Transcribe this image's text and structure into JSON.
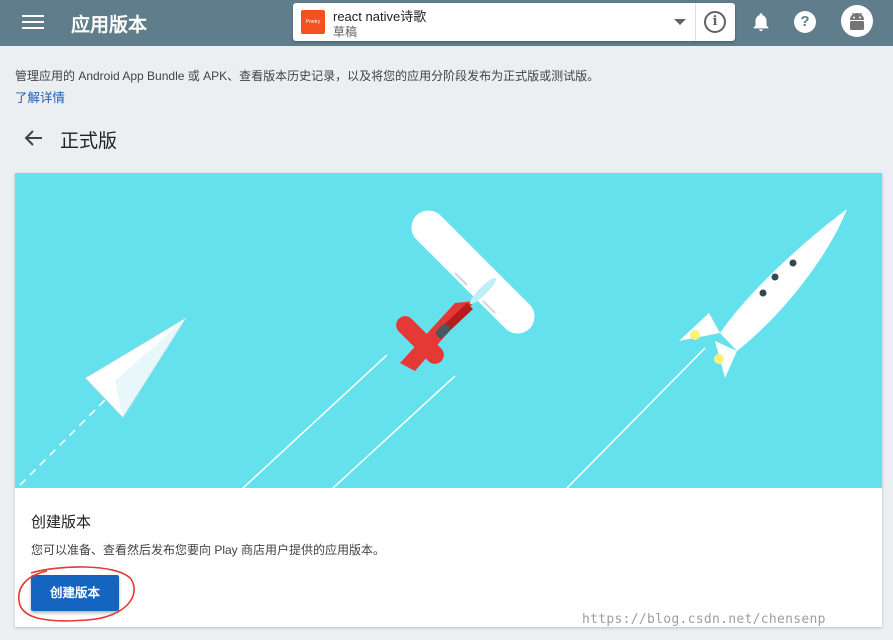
{
  "topbar": {
    "title": "应用版本",
    "app_name": "react native诗歌",
    "app_status": "草稿",
    "app_icon_text": "Poetry",
    "icons": [
      "menu-icon",
      "chevron-down-icon",
      "info-icon",
      "bell-icon",
      "help-icon",
      "android-avatar-icon"
    ]
  },
  "intro": {
    "description": "管理应用的 Android App Bundle 或 APK、查看版本历史记录，以及将您的应用分阶段发布为正式版或测试版。",
    "learn_more": "了解详情"
  },
  "page": {
    "title": "正式版"
  },
  "card": {
    "title": "创建版本",
    "description": "您可以准备、查看然后发布您要向 Play 商店用户提供的应用版本。",
    "button_label": "创建版本"
  },
  "watermark": "https://blog.csdn.net/chensenp",
  "colors": {
    "topbar": "#607d8b",
    "hero": "#64e1ec",
    "primary_button": "#1565c0",
    "annotation": "#e53935"
  }
}
